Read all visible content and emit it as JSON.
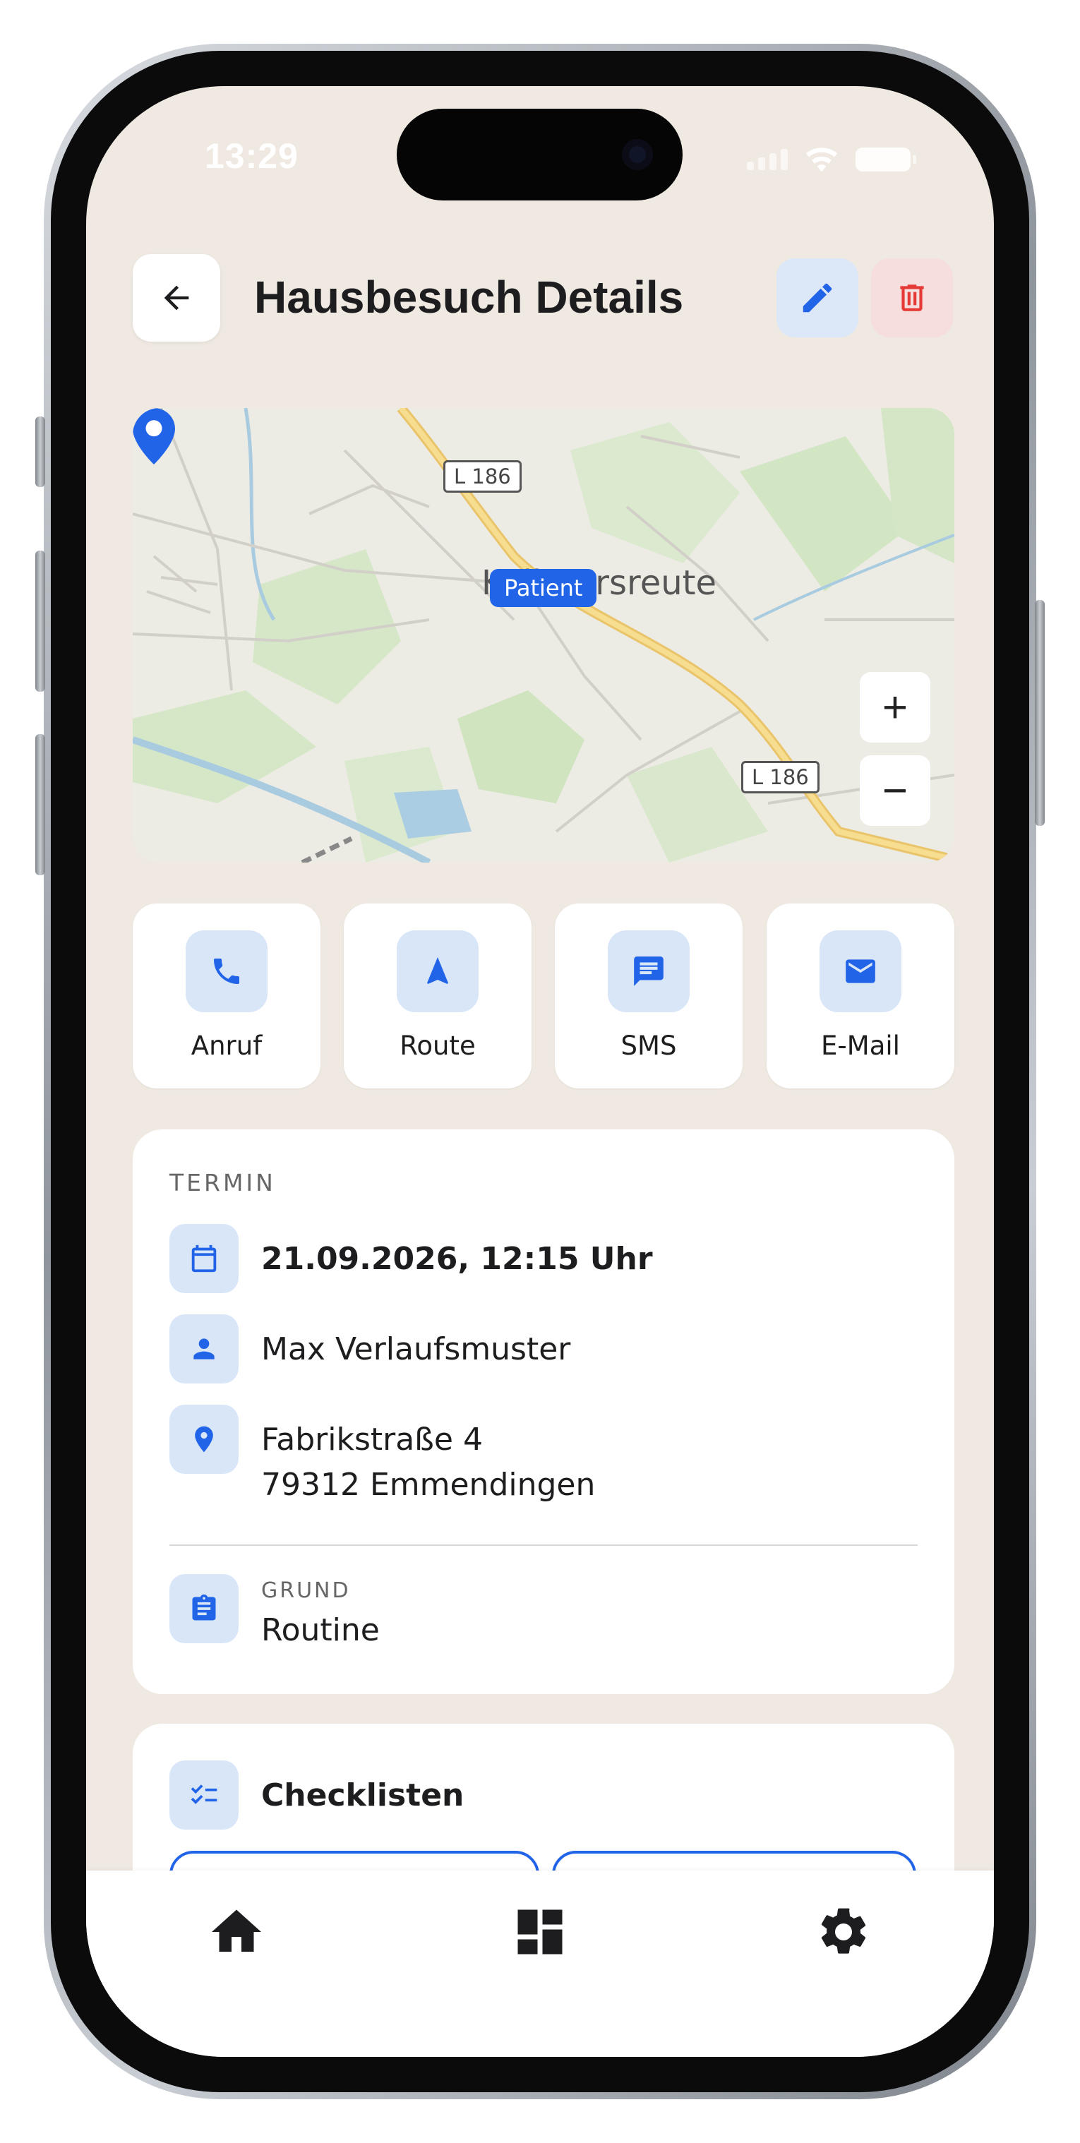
{
  "status_bar": {
    "time": "13:29"
  },
  "header": {
    "title": "Hausbesuch Details"
  },
  "map": {
    "place_label": "Kollmarsreute",
    "road_label_top": "L 186",
    "road_label_bottom": "L 186",
    "marker_label": "Patient",
    "zoom_in": "+",
    "zoom_out": "−"
  },
  "actions": [
    {
      "label": "Anruf",
      "icon": "phone-icon"
    },
    {
      "label": "Route",
      "icon": "navigation-icon"
    },
    {
      "label": "SMS",
      "icon": "message-icon"
    },
    {
      "label": "E-Mail",
      "icon": "mail-icon"
    }
  ],
  "appointment": {
    "section_label": "TERMIN",
    "datetime": "21.09.2026, 12:15 Uhr",
    "patient": "Max Verlaufsmuster",
    "address_line1": "Fabrikstraße 4",
    "address_line2": "79312 Emmendingen",
    "reason_label": "GRUND",
    "reason": "Routine"
  },
  "checklists": {
    "title": "Checklisten"
  },
  "colors": {
    "accent": "#2264e8",
    "icon_bg": "#d9e6f8",
    "danger": "#e53935",
    "background": "#efe9e2"
  },
  "bottom_nav": [
    {
      "icon": "home-icon"
    },
    {
      "icon": "dashboard-icon"
    },
    {
      "icon": "settings-icon"
    }
  ]
}
